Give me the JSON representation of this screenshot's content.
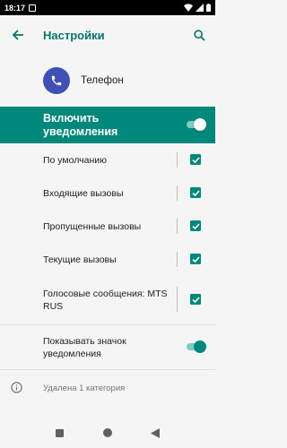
{
  "status_bar": {
    "time": "18:17"
  },
  "app_bar": {
    "title": "Настройки"
  },
  "app": {
    "name": "Телефон"
  },
  "master_toggle": {
    "label": "Включить уведомления",
    "on": true
  },
  "channels": [
    {
      "label": "По умолчанию",
      "checked": true
    },
    {
      "label": "Входящие вызовы",
      "checked": true
    },
    {
      "label": "Пропущенные вызовы",
      "checked": true
    },
    {
      "label": "Текущие вызовы",
      "checked": true
    },
    {
      "label": "Голосовые сообщения: MTS RUS",
      "checked": true
    }
  ],
  "badge_toggle": {
    "label": "Показывать значок уведомления",
    "on": true
  },
  "info": {
    "text": "Удалена 1 категория"
  },
  "colors": {
    "accent": "#00897b",
    "title": "#00796b",
    "app_icon_bg": "#3f51b5"
  }
}
